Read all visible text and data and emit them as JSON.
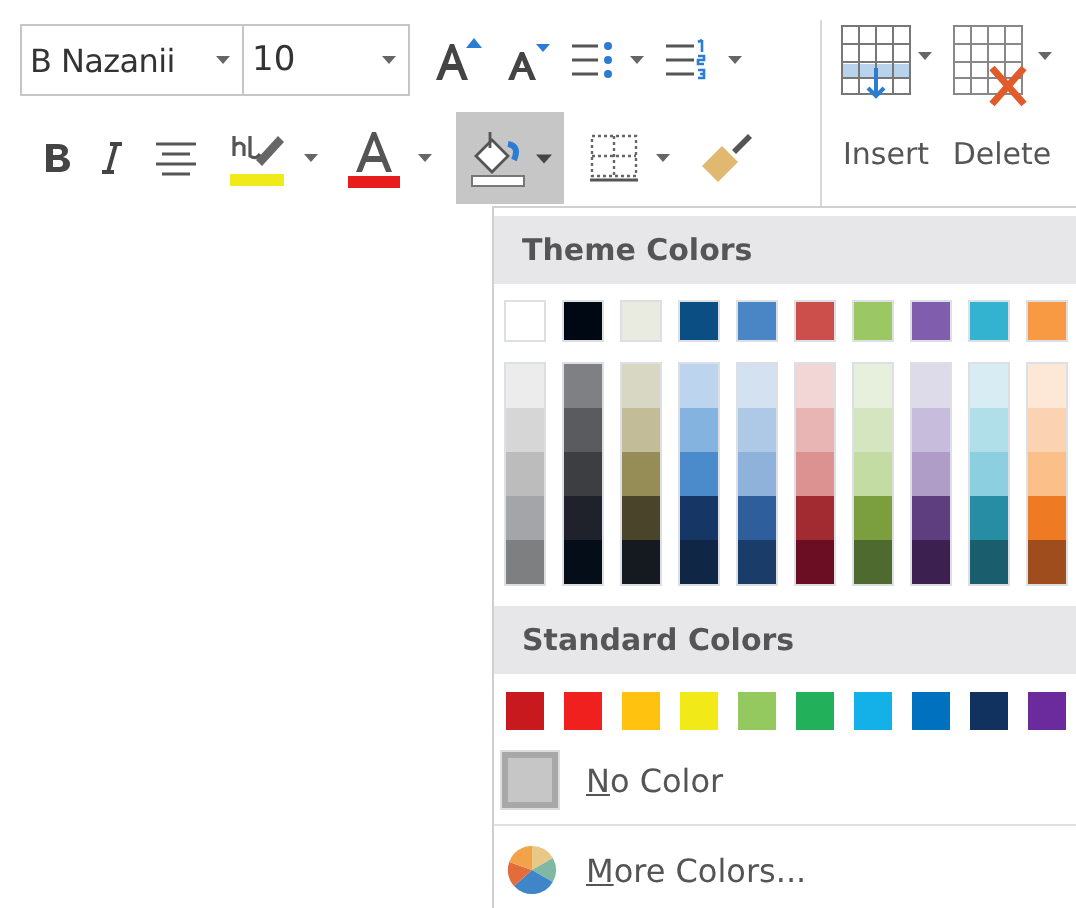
{
  "ribbon": {
    "font_name": "B Nazanii",
    "font_size": "10",
    "fill_button": {
      "selected": true
    },
    "insert_label": "Insert",
    "delete_label": "Delete"
  },
  "color_menu": {
    "theme_header": "Theme Colors",
    "theme_colors": [
      {
        "color": "#ffffff",
        "shades": [
          {
            "color": "#ececec"
          },
          {
            "color": "#d6d6d6"
          },
          {
            "color": "#bcbcbc"
          },
          {
            "color": "#a3a5a8"
          },
          {
            "color": "#7e7f80"
          }
        ]
      },
      {
        "color": "#000814",
        "shades": [
          {
            "color": "#7f8083"
          },
          {
            "color": "#595b5e"
          },
          {
            "color": "#3d3e42"
          },
          {
            "color": "#1f222a"
          },
          {
            "color": "#040d18"
          }
        ]
      },
      {
        "color": "#e9ebe0",
        "shades": [
          {
            "color": "#d8d7c4"
          },
          {
            "color": "#c2bd98"
          },
          {
            "color": "#968d56"
          },
          {
            "color": "#4a442a"
          },
          {
            "color": "#141a20"
          }
        ]
      },
      {
        "color": "#0a4e84",
        "shades": [
          {
            "color": "#bcd4ee"
          },
          {
            "color": "#84b3e0"
          },
          {
            "color": "#4b8bcc"
          },
          {
            "color": "#163766"
          },
          {
            "color": "#0f2744"
          }
        ]
      },
      {
        "color": "#4a86c6",
        "shades": [
          {
            "color": "#d3e1f0"
          },
          {
            "color": "#adc9e6"
          },
          {
            "color": "#8fb2da"
          },
          {
            "color": "#2e5f9c"
          },
          {
            "color": "#1a3c69"
          }
        ]
      },
      {
        "color": "#cd4f4c",
        "shades": [
          {
            "color": "#f2d6d6"
          },
          {
            "color": "#e8b4b4"
          },
          {
            "color": "#dc9291"
          },
          {
            "color": "#a22a31"
          },
          {
            "color": "#6b0e24"
          }
        ]
      },
      {
        "color": "#9bc865",
        "shades": [
          {
            "color": "#e7efdd"
          },
          {
            "color": "#d5e5c0"
          },
          {
            "color": "#c3dca4"
          },
          {
            "color": "#7b9e3f"
          },
          {
            "color": "#4f6a2e"
          }
        ]
      },
      {
        "color": "#815ead",
        "shades": [
          {
            "color": "#dddbea"
          },
          {
            "color": "#c7bcdc"
          },
          {
            "color": "#af9cc7"
          },
          {
            "color": "#5e3e7f"
          },
          {
            "color": "#3c2050"
          }
        ]
      },
      {
        "color": "#33b3cf",
        "shades": [
          {
            "color": "#d7ecf3"
          },
          {
            "color": "#b1dfe9"
          },
          {
            "color": "#8ccfe0"
          },
          {
            "color": "#268da5"
          },
          {
            "color": "#1a5e6e"
          }
        ]
      },
      {
        "color": "#f79a43",
        "shades": [
          {
            "color": "#fde7d6"
          },
          {
            "color": "#fcd3b2"
          },
          {
            "color": "#fbbf8a"
          },
          {
            "color": "#ee7b24"
          },
          {
            "color": "#a04d1e"
          }
        ]
      }
    ],
    "standard_header": "Standard Colors",
    "standard_colors": [
      {
        "color": "#c8191f"
      },
      {
        "color": "#f0201f"
      },
      {
        "color": "#ffc20e"
      },
      {
        "color": "#f2e919"
      },
      {
        "color": "#93c95e"
      },
      {
        "color": "#23b05a"
      },
      {
        "color": "#13b1e7"
      },
      {
        "color": "#0071be"
      },
      {
        "color": "#11325e"
      },
      {
        "color": "#6c2b9c"
      }
    ],
    "no_color_label": "No Color",
    "more_colors_label": "More Colors..."
  }
}
